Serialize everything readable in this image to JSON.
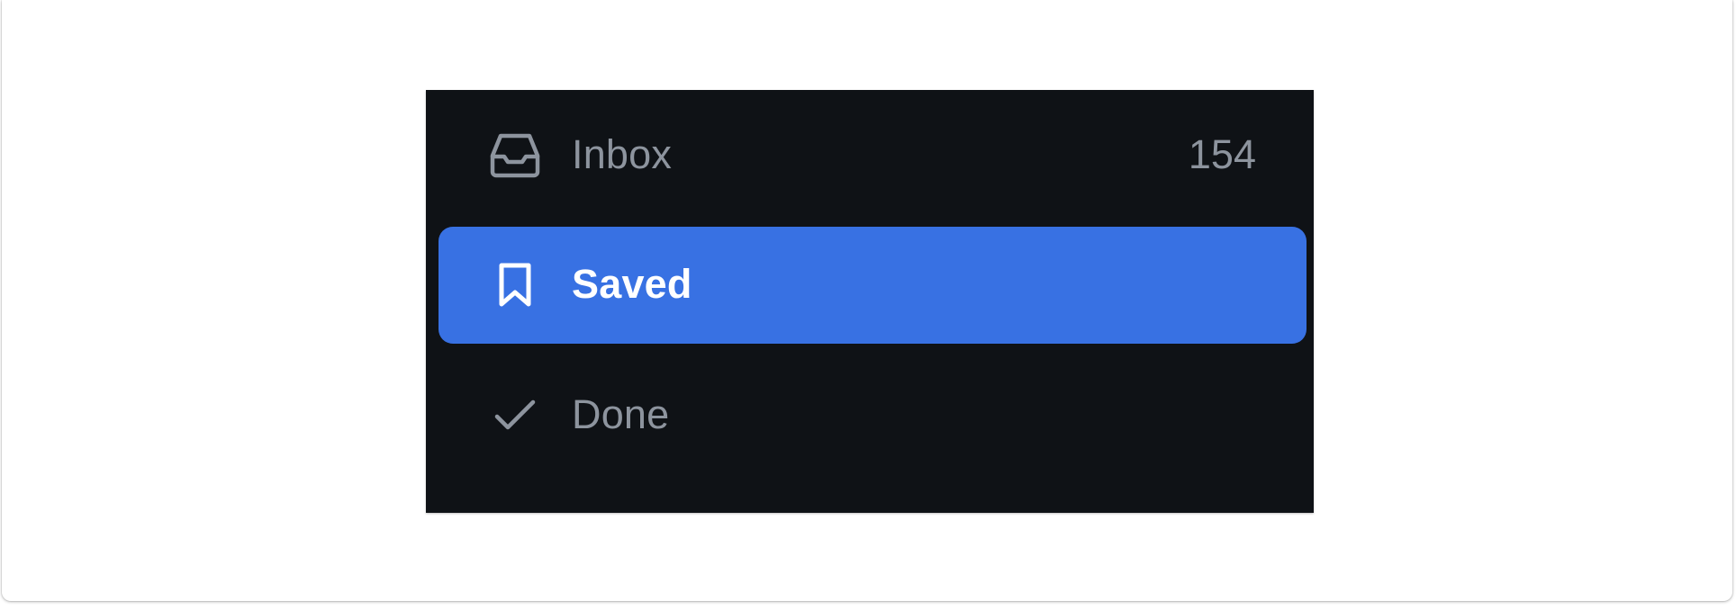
{
  "nav": {
    "items": [
      {
        "label": "Inbox",
        "count": "154",
        "icon": "inbox-icon",
        "selected": false
      },
      {
        "label": "Saved",
        "icon": "bookmark-icon",
        "selected": true
      },
      {
        "label": "Done",
        "icon": "check-icon",
        "selected": false
      }
    ]
  },
  "colors": {
    "panel_background": "#0f1216",
    "selected_background": "#3871e3",
    "muted_text": "#8d949e",
    "selected_text": "#ffffff",
    "page_background": "#ffffff"
  }
}
